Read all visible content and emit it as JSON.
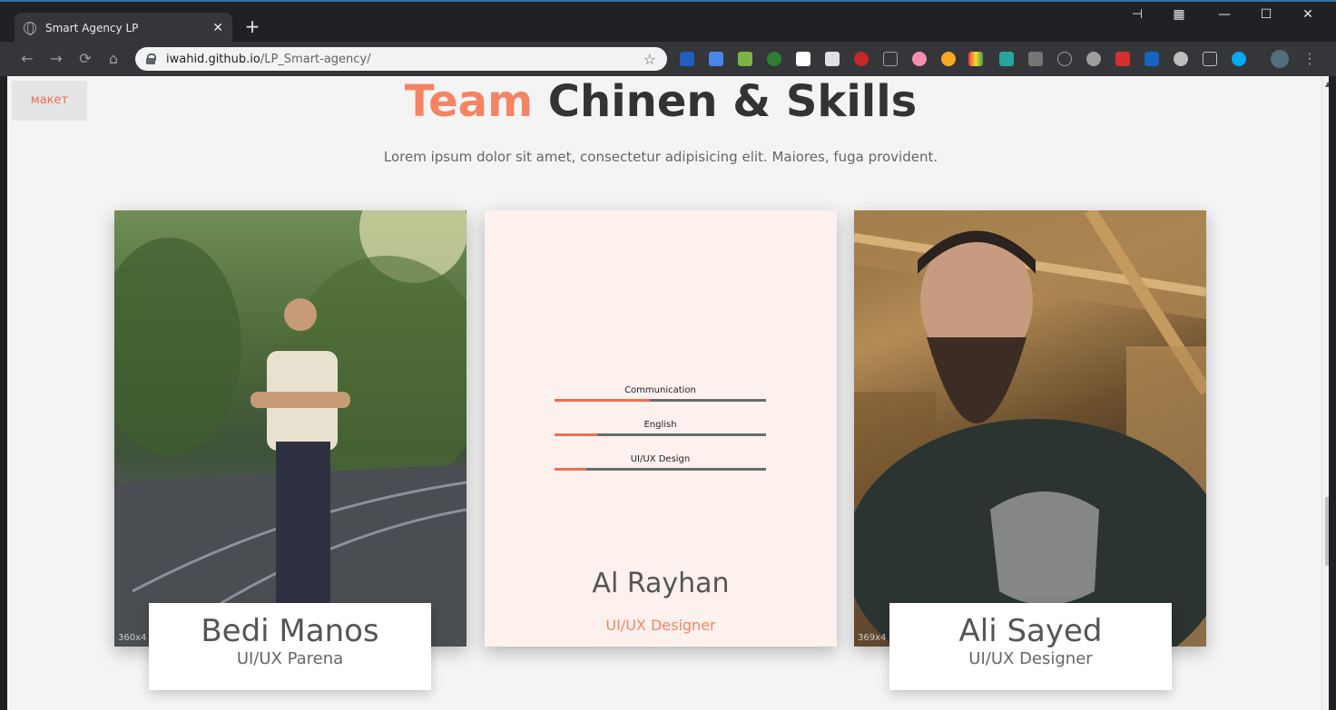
{
  "browser": {
    "tab_title": "Smart Agency LP",
    "url_host": "iwahid.github.io",
    "url_path": "/LP_Smart-agency/"
  },
  "page": {
    "maket_label": "макет",
    "heading_accent": "Team",
    "heading_rest": "Chinen & Skills",
    "subtitle": "Lorem ipsum dolor sit amet, consectetur adipisicing elit. Maiores, fuga provident."
  },
  "team": [
    {
      "name": "Bedi Manos",
      "role": "UI/UX Parena",
      "dim": "360x4"
    },
    {
      "name": "Al Rayhan",
      "role": "UI/UX Designer"
    },
    {
      "name": "Ali Sayed",
      "role": "UI/UX Designer",
      "dim": "369x4"
    }
  ],
  "skills": [
    {
      "label": "Communication",
      "level": 0.45
    },
    {
      "label": "English",
      "level": 0.2
    },
    {
      "label": "UI/UX Design",
      "level": 0.15
    }
  ],
  "colors": {
    "accent": "#f06f4e",
    "heading": "#333333"
  }
}
